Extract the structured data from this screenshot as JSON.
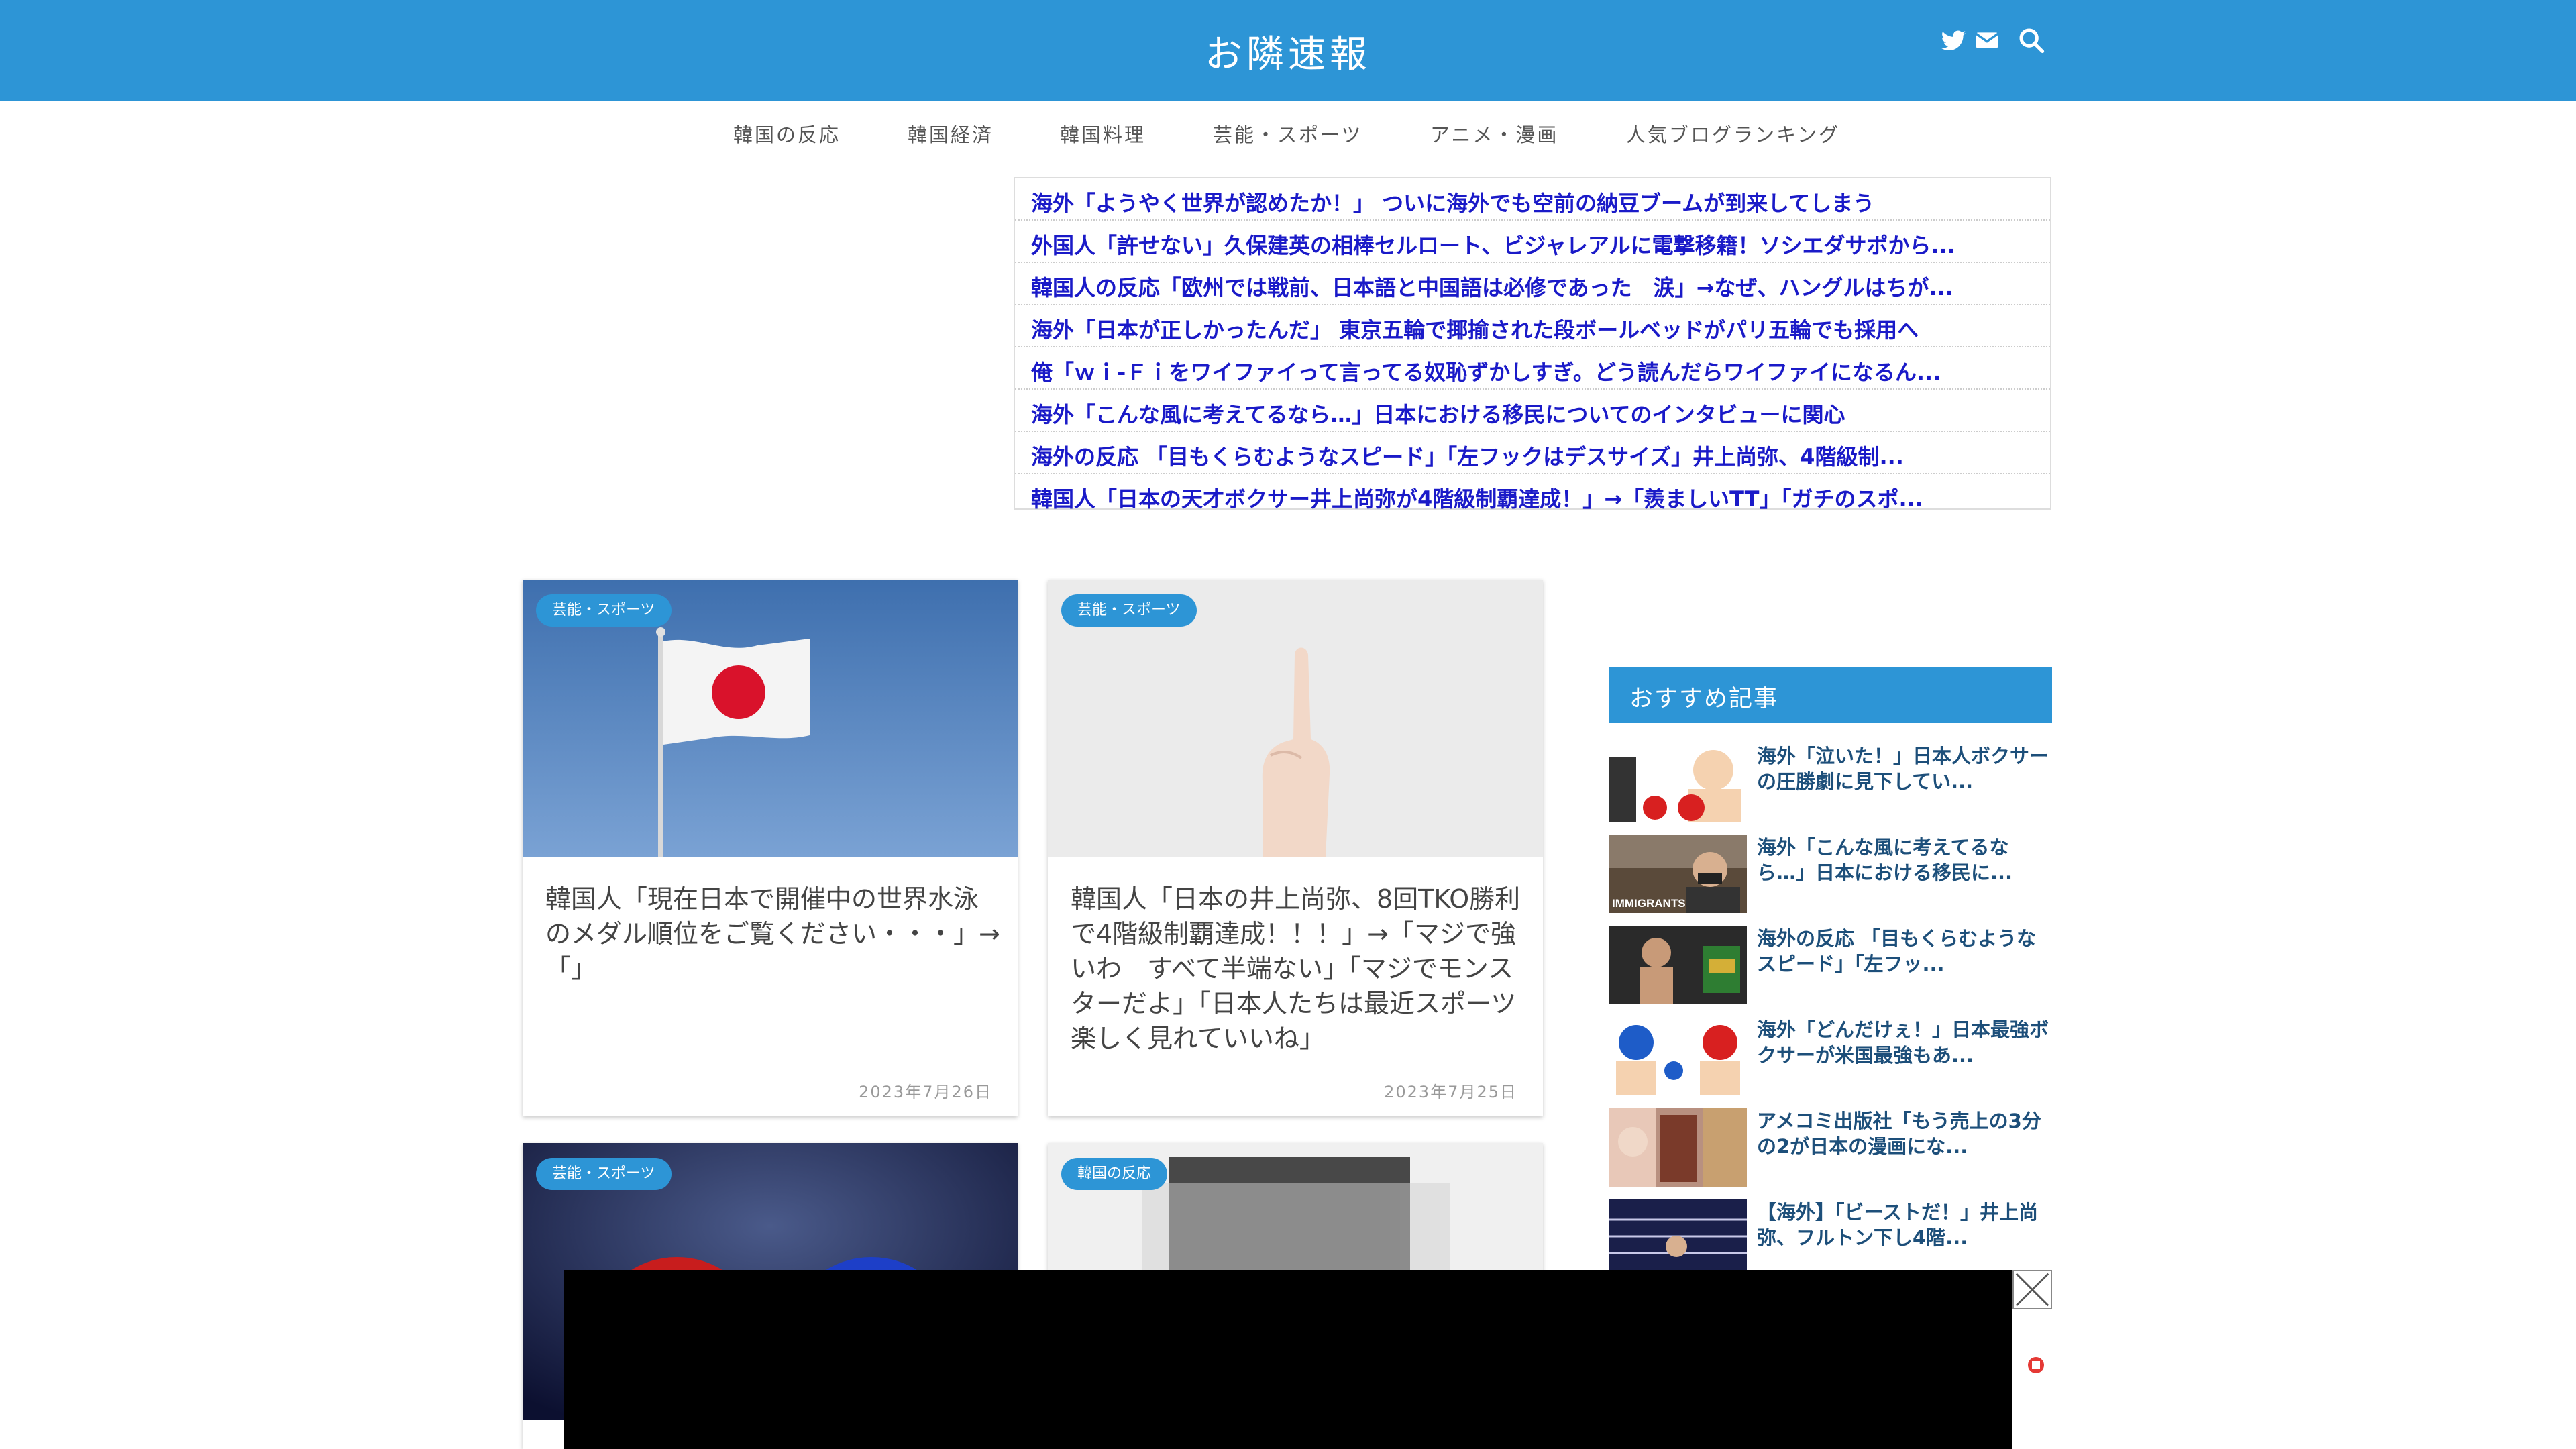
{
  "header": {
    "title": "お隣速報",
    "accent": "#2d95d6"
  },
  "nav": {
    "items": [
      {
        "label": "韓国の反応"
      },
      {
        "label": "韓国経済"
      },
      {
        "label": "韓国料理"
      },
      {
        "label": "芸能・スポーツ"
      },
      {
        "label": "アニメ・漫画"
      },
      {
        "label": "人気ブログランキング"
      }
    ]
  },
  "headlines": [
    "海外「ようやく世界が認めたか！」 ついに海外でも空前の納豆ブームが到来してしまう",
    "外国人「許せない」久保建英の相棒セルロート、ビジャレアルに電撃移籍！ソシエダサポから...",
    "韓国人の反応「欧州では戦前、日本語と中国語は必修であった　涙」→なぜ、ハングルはちが...",
    "海外「日本が正しかったんだ」 東京五輪で揶揄された段ボールベッドがパリ五輪でも採用へ",
    "俺「ｗｉ-Ｆｉをワイファイって言ってる奴恥ずかしすぎ。どう読んだらワイファイになるん...",
    "海外「こんな風に考えてるなら…」日本における移民についてのインタビューに関心",
    "海外の反応 「目もくらむようなスピード」「左フックはデスサイズ」井上尚弥、4階級制...",
    "韓国人「日本の天才ボクサー井上尚弥が4階級制覇達成！」→「羨ましいTT」「ガチのスポ..."
  ],
  "cards": [
    {
      "category": "芸能・スポーツ",
      "title": "韓国人「現在日本で開催中の世界水泳のメダル順位をご覧ください・・・」→「」",
      "date": "2023年7月26日"
    },
    {
      "category": "芸能・スポーツ",
      "title": "韓国人「日本の井上尚弥、8回TKO勝利で4階級制覇達成！！！」→「マジで強いわ　すべて半端ない」「マジでモンスターだよ」「日本人たちは最近スポーツ楽しく見れていいね」",
      "date": "2023年7月25日"
    },
    {
      "category": "芸能・スポーツ"
    },
    {
      "category": "韓国の反応"
    }
  ],
  "sidebar": {
    "heading": "おすすめ記事",
    "items": [
      {
        "title": "海外「泣いた！」日本人ボクサーの圧勝劇に見下してい..."
      },
      {
        "title": "海外「こんな風に考えてるなら…」日本における移民に...",
        "thumb_text": "IMMIGRANTS"
      },
      {
        "title": "海外の反応 「目もくらむようなスピード」「左フッ..."
      },
      {
        "title": "海外「どんだけぇ！」日本最強ボクサーが米国最強もあ..."
      },
      {
        "title": "アメコミ出版社「もう売上の3分の2が日本の漫画にな..."
      },
      {
        "title": "【海外】「ビーストだ！」井上尚弥、フルトン下し4階..."
      }
    ]
  },
  "icons": {
    "twitter": "twitter-icon",
    "mail": "mail-icon",
    "search": "search-icon",
    "ad_close": "close-icon"
  }
}
